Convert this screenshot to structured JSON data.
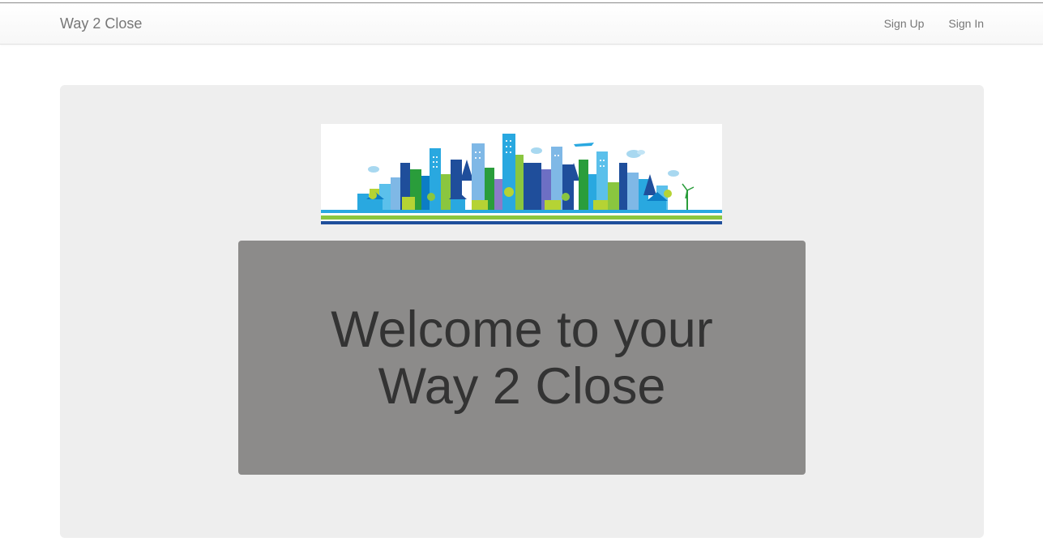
{
  "navbar": {
    "brand": "Way 2 Close",
    "links": [
      {
        "label": "Sign Up"
      },
      {
        "label": "Sign In"
      }
    ]
  },
  "hero": {
    "banner_image": "city-skyline-illustration",
    "heading_line1": "Welcome to your",
    "heading_line2": "Way 2 Close"
  },
  "colors": {
    "navbar_text": "#777777",
    "jumbotron_bg": "#eeeeee",
    "welcome_box_bg": "#8c8b8a",
    "welcome_text": "#333333"
  }
}
